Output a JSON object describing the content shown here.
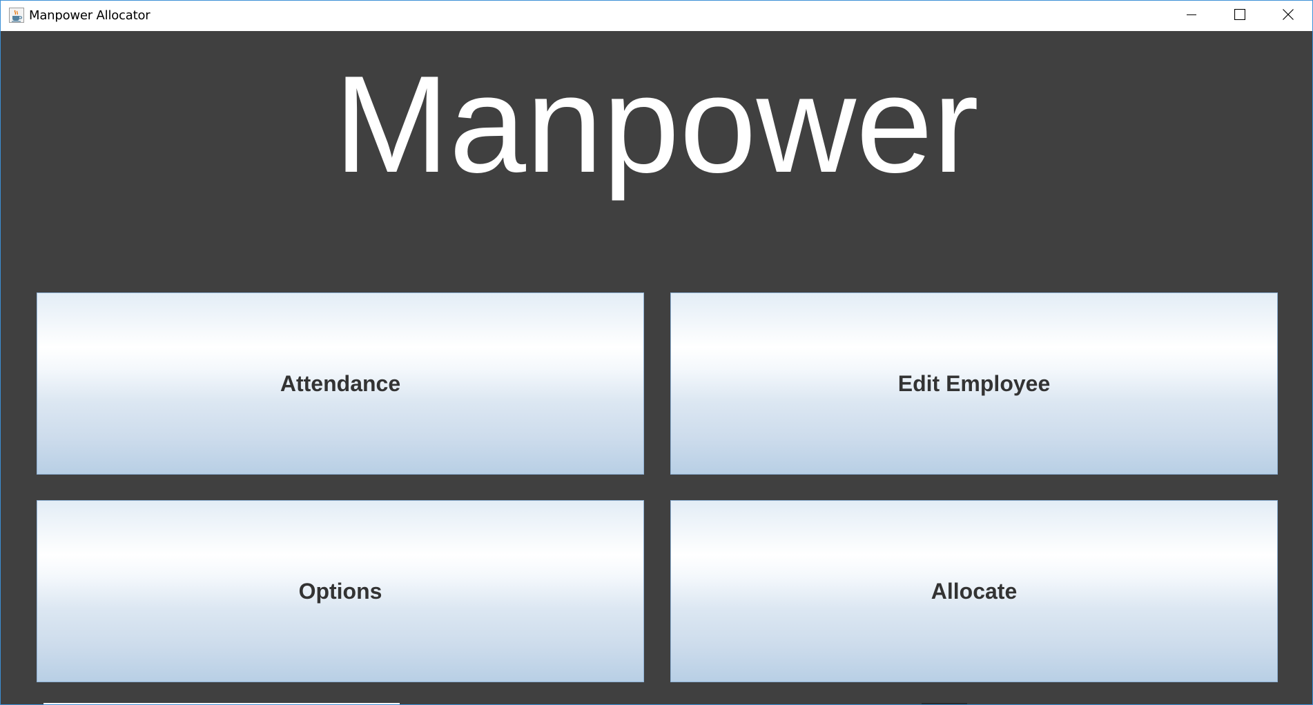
{
  "window": {
    "title": "Manpower Allocator"
  },
  "icons": {
    "app": "java-coffee-cup-icon",
    "minimize": "minimize-icon",
    "maximize": "maximize-icon",
    "close": "close-icon"
  },
  "colors": {
    "background": "#404040",
    "titlebar": "#ffffff",
    "heading_text": "#ffffff",
    "button_text": "#333333",
    "button_gradient_top": "#ffffff",
    "button_gradient_bottom": "#b8cfe5",
    "window_border": "#3b8fd6"
  },
  "main": {
    "heading": "Manpower",
    "buttons": [
      {
        "label": "Attendance"
      },
      {
        "label": "Edit Employee"
      },
      {
        "label": "Options"
      },
      {
        "label": "Allocate"
      }
    ]
  }
}
